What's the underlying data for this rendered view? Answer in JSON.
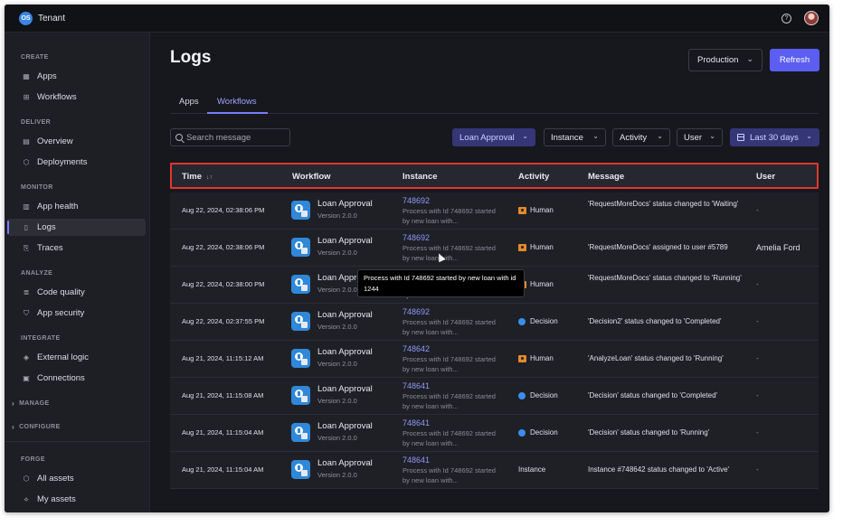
{
  "app": {
    "logo_text": "OS",
    "tenant": "Tenant"
  },
  "sidebar": {
    "sections": [
      {
        "title": "CREATE",
        "items": [
          {
            "label": "Apps",
            "icon": "grid-icon"
          },
          {
            "label": "Workflows",
            "icon": "workflow-icon"
          }
        ]
      },
      {
        "title": "DELIVER",
        "items": [
          {
            "label": "Overview",
            "icon": "overview-icon"
          },
          {
            "label": "Deployments",
            "icon": "deploy-icon"
          }
        ]
      },
      {
        "title": "MONITOR",
        "items": [
          {
            "label": "App health",
            "icon": "bar-chart-icon"
          },
          {
            "label": "Logs",
            "icon": "logs-icon",
            "active": true
          },
          {
            "label": "Traces",
            "icon": "traces-icon"
          }
        ]
      },
      {
        "title": "ANALYZE",
        "items": [
          {
            "label": "Code quality",
            "icon": "code-quality-icon"
          },
          {
            "label": "App security",
            "icon": "shield-icon"
          }
        ]
      },
      {
        "title": "INTEGRATE",
        "items": [
          {
            "label": "External logic",
            "icon": "layers-icon"
          },
          {
            "label": "Connections",
            "icon": "connections-icon"
          }
        ]
      }
    ],
    "collapsed": [
      "MANAGE",
      "CONFIGURE"
    ],
    "forge": {
      "title": "FORGE",
      "items": [
        {
          "label": "All assets",
          "icon": "assets-icon"
        },
        {
          "label": "My assets",
          "icon": "my-assets-icon"
        }
      ]
    }
  },
  "header": {
    "title": "Logs",
    "environment": "Production",
    "refresh_label": "Refresh"
  },
  "tabs": [
    {
      "label": "Apps"
    },
    {
      "label": "Workflows",
      "active": true
    }
  ],
  "filters": {
    "search_placeholder": "Search message",
    "workflow": "Loan Approval",
    "instance": "Instance",
    "activity": "Activity",
    "user": "User",
    "date_range": "Last 30 days"
  },
  "table": {
    "columns": [
      "Time",
      "Workflow",
      "Instance",
      "Activity",
      "Message",
      "User"
    ],
    "rows": [
      {
        "time": "Aug 22, 2024, 02:38:06 PM",
        "workflow": "Loan Approval",
        "version": "Version 2.0.0",
        "instance_id": "748692",
        "instance_desc": "Process with Id 748692 started by new loan with...",
        "activity": "Human",
        "activity_type": "human",
        "message": "'RequestMoreDocs' status changed to 'Waiting'",
        "user": "-"
      },
      {
        "time": "Aug 22, 2024, 02:38:06 PM",
        "workflow": "Loan Approval",
        "version": "Version 2.0.0",
        "instance_id": "748692",
        "instance_desc": "Process with Id 748692 started by new loan with...",
        "activity": "Human",
        "activity_type": "human",
        "message": "'RequestMoreDocs' assigned to user #5789",
        "user": "Amelia Ford"
      },
      {
        "time": "Aug 22, 2024, 02:38:00 PM",
        "workflow": "Loan Approval",
        "version": "Version 2.0.0",
        "instance_id": "748692",
        "instance_desc": "Process with Id 748692 started by new loan with...",
        "activity": "Human",
        "activity_type": "human",
        "message": "'RequestMoreDocs' status changed to 'Running'",
        "user": "-"
      },
      {
        "time": "Aug 22, 2024, 02:37:55 PM",
        "workflow": "Loan Approval",
        "version": "Version 2.0.0",
        "instance_id": "748692",
        "instance_desc": "Process with Id 748692 started by new loan with...",
        "activity": "Decision",
        "activity_type": "decision",
        "message": "'Decision2' status changed to 'Completed'",
        "user": "-"
      },
      {
        "time": "Aug 21, 2024, 11:15:12 AM",
        "workflow": "Loan Approval",
        "version": "Version 2.0.0",
        "instance_id": "748642",
        "instance_desc": "Process with Id 748692 started by new loan with...",
        "activity": "Human",
        "activity_type": "human",
        "message": "'AnalyzeLoan' status changed to 'Running'",
        "user": "-"
      },
      {
        "time": "Aug 21, 2024, 11:15:08 AM",
        "workflow": "Loan Approval",
        "version": "Version 2.0.0",
        "instance_id": "748641",
        "instance_desc": "Process with Id 748692 started by new loan with...",
        "activity": "Decision",
        "activity_type": "decision",
        "message": "'Decision' status changed to 'Completed'",
        "user": "-"
      },
      {
        "time": "Aug 21, 2024, 11:15:04 AM",
        "workflow": "Loan Approval",
        "version": "Version 2.0.0",
        "instance_id": "748641",
        "instance_desc": "Process with Id 748692 started by new loan with...",
        "activity": "Decision",
        "activity_type": "decision",
        "message": "'Decision' status changed to 'Running'",
        "user": "-"
      },
      {
        "time": "Aug 21, 2024, 11:15:04 AM",
        "workflow": "Loan Approval",
        "version": "Version 2.0.0",
        "instance_id": "748641",
        "instance_desc": "Process with Id 748692 started by new loan with...",
        "activity": "Instance",
        "activity_type": "instance",
        "message": "Instance #748642 status changed to 'Active'",
        "user": "-"
      }
    ]
  },
  "tooltip": "Process with Id 748692 started by new loan with id 1244",
  "colors": {
    "accent": "#5b5ef0",
    "link": "#8f98f8",
    "highlight_border": "#e0372f",
    "human": "#e18a2c",
    "decision": "#3a8ef0"
  }
}
